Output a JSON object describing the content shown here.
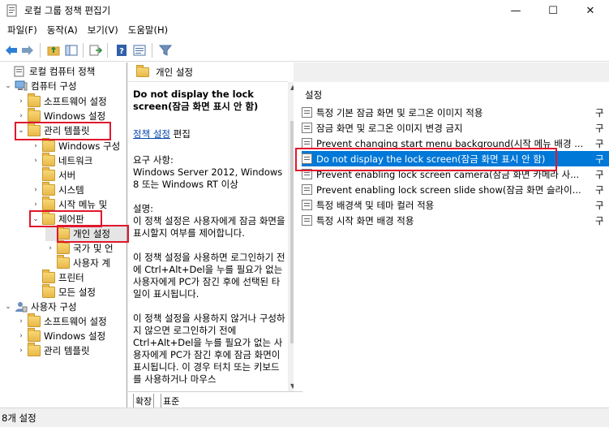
{
  "window": {
    "title": "로컬 그룹 정책 편집기",
    "min_glyph": "—",
    "max_glyph": "☐",
    "close_glyph": "✕"
  },
  "menu": [
    "파일(F)",
    "동작(A)",
    "보기(V)",
    "도움말(H)"
  ],
  "toolbar": {
    "icons": [
      "back-arrow-icon",
      "forward-arrow-icon",
      "up-folder-icon",
      "show-hide-tree-icon",
      "export-list-icon",
      "help-icon",
      "properties-icon",
      "filter-icon"
    ]
  },
  "tree": {
    "root": "로컬 컴퓨터 정책",
    "computer_config": "컴퓨터 구성",
    "software_settings": "소프트웨어 설정",
    "windows_settings": "Windows 설정",
    "admin_templates": "관리 템플릿",
    "windows_components": "Windows 구성",
    "network": "네트워크",
    "server": "서버",
    "system": "시스템",
    "start_menu": "시작 메뉴 및",
    "control_panel": "제어판",
    "personalization": "개인 설정",
    "region_language": "국가 및 언",
    "user_accounts": "사용자 계",
    "printers": "프린터",
    "all_settings": "모든 설정",
    "user_config": "사용자 구성",
    "u_software_settings": "소프트웨어 설정",
    "u_windows_settings": "Windows 설정",
    "u_admin_templates": "관리 템플릿"
  },
  "description": {
    "header": "개인 설정",
    "policy_title": "Do not display the lock screen(잠금 화면 표시 안 함)",
    "edit_link": "정책 설정",
    "edit_suffix": " 편집",
    "requirements_label": "요구 사항:",
    "requirements": "Windows Server 2012, Windows 8 또는 Windows RT 이상",
    "description_label": "설명:",
    "para1": "이 정책 설정은 사용자에게 잠금 화면을 표시할지 여부를 제어합니다.",
    "para2": "이 정책 설정을 사용하면 로그인하기 전에 Ctrl+Alt+Del을 누를 필요가 없는 사용자에게 PC가 잠긴 후에 선택된 타일이 표시됩니다.",
    "para3": "이 정책 설정을 사용하지 않거나 구성하지 않으면 로그인하기 전에 Ctrl+Alt+Del을 누를 필요가 없는 사용자에게 PC가 잠긴 후에 잠금 화면이 표시됩니다. 이 경우 터치 또는 키보드를 사용하거나 마우스"
  },
  "tabs": {
    "extended": "확장",
    "standard": "표준"
  },
  "list": {
    "header": "설정",
    "rows": [
      {
        "name": "특정 기본 잠금 화면 및 로그온 이미지 적용",
        "state": "구"
      },
      {
        "name": "잠금 화면 및 로그온 이미지 변경 금지",
        "state": "구"
      },
      {
        "name": "Prevent changing start menu background(시작 메뉴 배경 ...",
        "state": "구"
      },
      {
        "name": "Do not display the lock screen(잠금 화면 표시 안 함)",
        "state": "구"
      },
      {
        "name": "Prevent enabling lock screen camera(잠금 화면 카메라 사...",
        "state": "구"
      },
      {
        "name": "Prevent enabling lock screen slide show(잠금 화면 슬라이...",
        "state": "구"
      },
      {
        "name": "특정 배경색 및 테마 컬러 적용",
        "state": "구"
      },
      {
        "name": "특정 시작 화면 배경 적용",
        "state": "구"
      }
    ]
  },
  "status": {
    "text": "8개 설정"
  },
  "colors": {
    "selection": "#0078d7",
    "highlight_box": "#e0182d",
    "link": "#0645ad"
  }
}
